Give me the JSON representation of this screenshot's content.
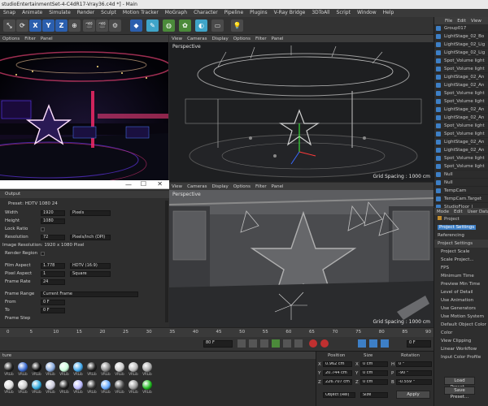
{
  "window": {
    "title": "studioEntertainmentSet-4-C4dR17-Vray36.c4d *] - Main"
  },
  "menu": [
    "Snap",
    "Animate",
    "Simulate",
    "Render",
    "Sculpt",
    "Motion Tracker",
    "MoGraph",
    "Character",
    "Pipeline",
    "Plugins",
    "V-Ray Bridge",
    "3DToAll",
    "Script",
    "Window",
    "Help"
  ],
  "toolbar": {
    "x": "X",
    "y": "Y",
    "z": "Z"
  },
  "left_menu": {
    "options": "Options",
    "filter": "Filter",
    "panel": "Panel"
  },
  "viewport_menu": [
    "View",
    "Cameras",
    "Display",
    "Options",
    "Filter",
    "Panel"
  ],
  "viewports": [
    {
      "label": "Perspective",
      "grid": "Grid Spacing : 1000 cm"
    },
    {
      "label": "Perspective",
      "grid": "Grid Spacing : 1000 cm"
    }
  ],
  "output": {
    "section": "Output",
    "preset_label": "Preset: HDTV 1080 24",
    "fields": [
      {
        "label": "Width",
        "value": "1920",
        "unit": "Pixels"
      },
      {
        "label": "Height",
        "value": "1080",
        "unit": ""
      },
      {
        "label": "Lock Ratio",
        "value": "",
        "unit": ""
      },
      {
        "label": "Resolution",
        "value": "72",
        "unit": "Pixels/Inch (DPI)"
      }
    ],
    "image_res": "Image Resolution: 1920 x 1080 Pixel",
    "render_region": "Render Region",
    "film_aspect_label": "Film Aspect",
    "film_aspect_value": "1.778",
    "film_aspect_option": "HDTV (16:9)",
    "pixel_aspect_label": "Pixel Aspect",
    "pixel_aspect_value": "1",
    "pixel_aspect_option": "Square",
    "frame_rate_label": "Frame Rate",
    "frame_rate_value": "24",
    "frame_range_label": "Frame Range",
    "frame_range_value": "Current Frame",
    "from_label": "From",
    "from_value": "0 F",
    "to_label": "To",
    "to_value": "0 F",
    "frame_step_label": "Frame Step"
  },
  "objects": {
    "menu": [
      "File",
      "Edit",
      "View"
    ],
    "items": [
      "Group017",
      "LightStage_02_Bo",
      "LightStage_02_Lig",
      "LightStage_02_Lig",
      "Spot_Volume light",
      "Spot_Volume light",
      "LightStage_02_An",
      "LightStage_02_An",
      "Spot_Volume light",
      "Spot_Volume light",
      "LightStage_02_An",
      "LightStage_02_An",
      "Spot_Volume light",
      "Spot_Volume light",
      "LightStage_02_An",
      "LightStage_02_An",
      "Spot_Volume light",
      "Spot_Volume light",
      "Null",
      "Null",
      "TempCam",
      "TempCam.Target",
      "StudioFloor_l"
    ]
  },
  "attributes": {
    "tabs": [
      "Mode",
      "Edit",
      "User Data"
    ],
    "title": "Project",
    "active_tab": "Project Settings",
    "sub_tab": "Referencing",
    "section": "Project Settings",
    "rows": [
      "Project Scale",
      "Scale Project...",
      "FPS",
      "Minimum Time",
      "Preview Min Time",
      "Level of Detail",
      "Use Animation",
      "Use Generators",
      "Use Motion System",
      "Default Object Color",
      "Color",
      "View Clipping",
      "Linear Workflow",
      "Input Color Profile"
    ],
    "load_preset": "Load Preset...",
    "save_preset": "Save Preset..."
  },
  "timeline": {
    "ticks": [
      "0",
      "5",
      "10",
      "15",
      "20",
      "25",
      "30",
      "35",
      "40",
      "45",
      "50",
      "55",
      "60",
      "65",
      "70",
      "75",
      "80",
      "85",
      "90"
    ],
    "frame_field": "80 F",
    "end_field": "0 F"
  },
  "materials": {
    "header": "ture",
    "menu": [
      "File",
      "Edit",
      "Function",
      "Texture"
    ],
    "names": [
      "VRLib",
      "VRLib",
      "VRLib",
      "VRLib",
      "VRLib",
      "VRLib",
      "VRLib",
      "VRLib",
      "VRLib",
      "VRLib",
      "VRLib",
      "VRLib",
      "VRLib",
      "VRLib",
      "VRLib",
      "VRLib",
      "VRLib",
      "VRLib",
      "VRLib",
      "VRLib",
      "VRLib",
      "VRLib"
    ]
  },
  "coordinates": {
    "headers": [
      "Position",
      "Size",
      "Rotation"
    ],
    "rows": [
      {
        "axis": "X",
        "pos": "0.962 cm",
        "size_axis": "X",
        "size": "0 cm",
        "rot_axis": "H",
        "rot": "0 °"
      },
      {
        "axis": "Y",
        "pos": "20.744 cm",
        "size_axis": "Y",
        "size": "0 cm",
        "rot_axis": "P",
        "rot": "-90 °"
      },
      {
        "axis": "Z",
        "pos": "226.707 cm",
        "size_axis": "Z",
        "size": "0 cm",
        "rot_axis": "B",
        "rot": "-0.559 °"
      }
    ],
    "mode": "Object (Rel)",
    "size_mode": "Size",
    "apply": "Apply"
  },
  "colors": {
    "accent": "#3d7fc6",
    "bg": "#2b2b2b",
    "panel": "#2e2e2e"
  }
}
